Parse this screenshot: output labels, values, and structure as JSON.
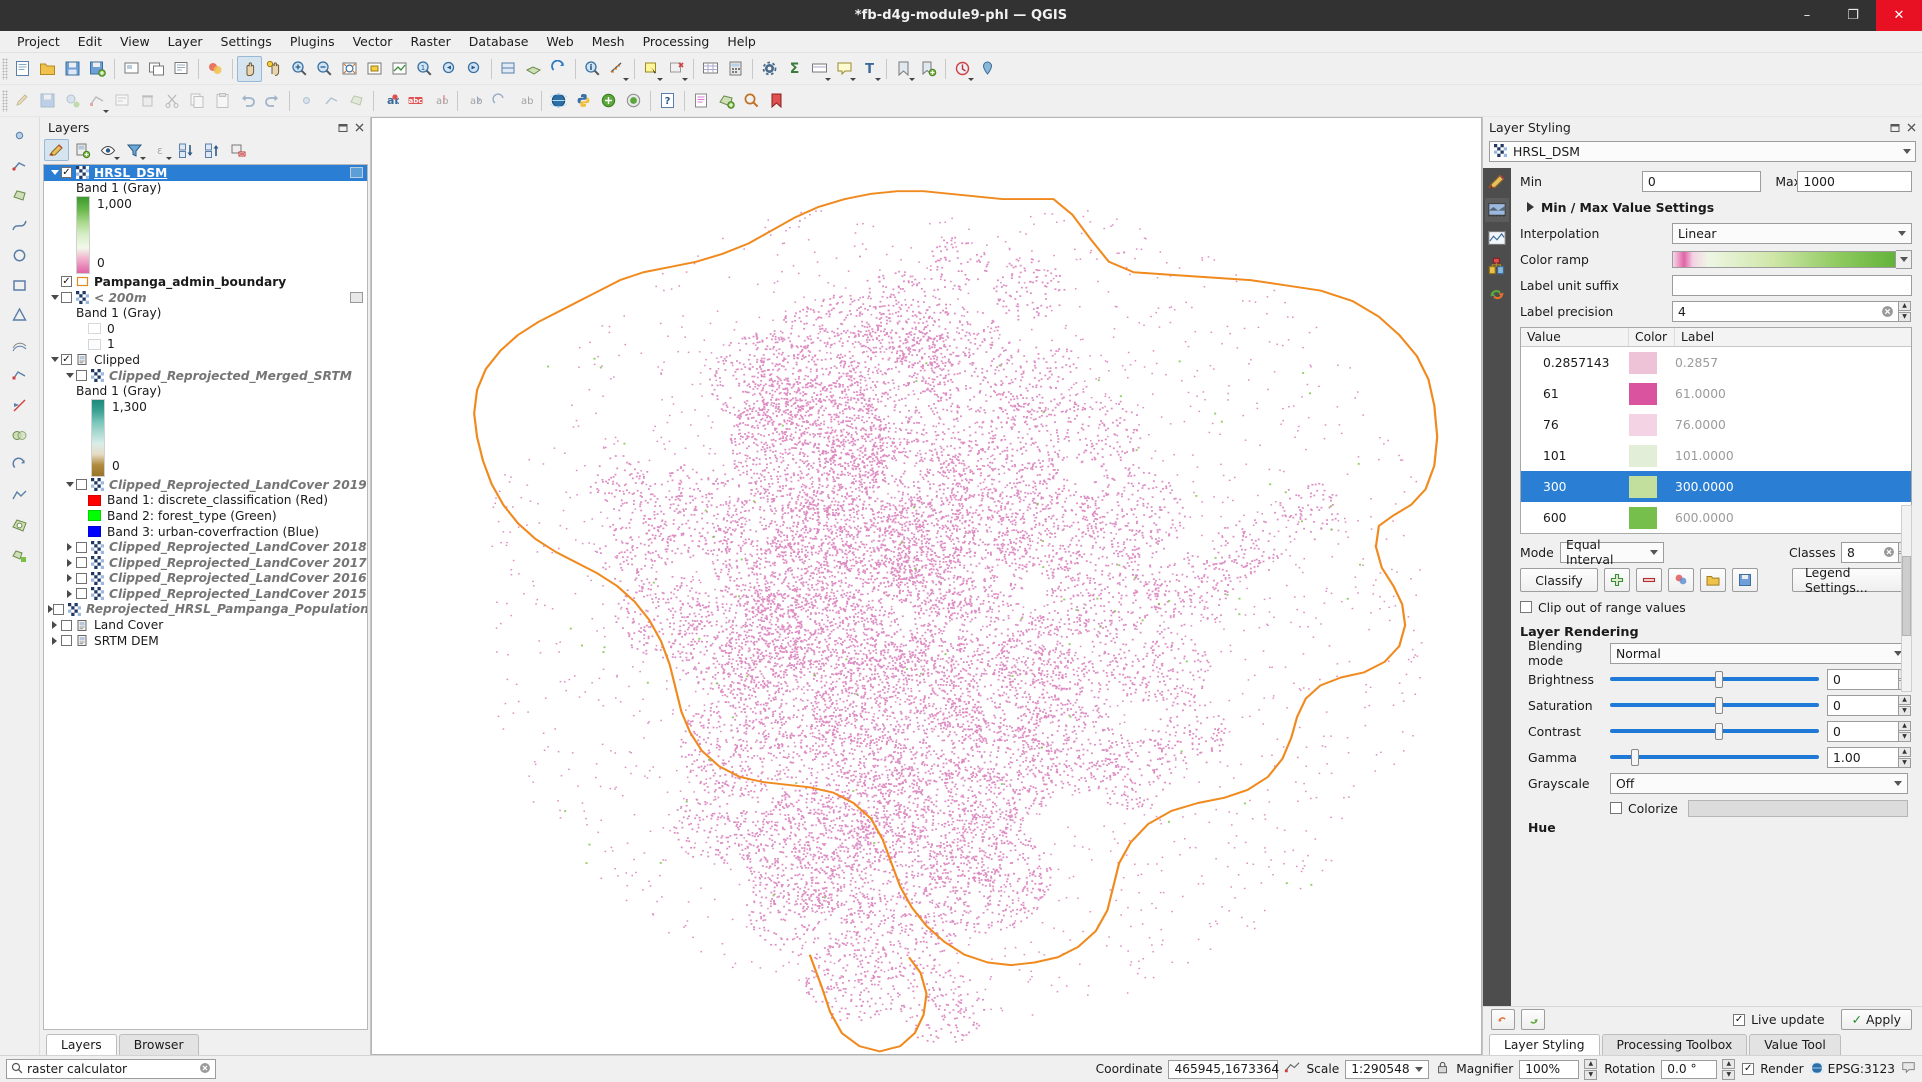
{
  "window": {
    "title": "*fb-d4g-module9-phl — QGIS",
    "minimize": "–",
    "maximize": "❐",
    "close": "✕"
  },
  "menubar": [
    "Project",
    "Edit",
    "View",
    "Layer",
    "Settings",
    "Plugins",
    "Vector",
    "Raster",
    "Database",
    "Web",
    "Mesh",
    "Processing",
    "Help"
  ],
  "layers_panel": {
    "title": "Layers",
    "toolbar_icons": [
      "open-layer-styling-panel-icon",
      "add-group-icon",
      "manage-layer-visibility-icon",
      "filter-legend-icon",
      "filter-legend-expression-icon",
      "expand-all-icon",
      "collapse-all-icon",
      "remove-layer-icon"
    ],
    "tree": [
      {
        "type": "layer",
        "indent": 0,
        "expander": "down",
        "checked": true,
        "selected": true,
        "icon": "raster-icon",
        "name": "HRSL_DSM",
        "style": "bold-underline"
      },
      {
        "type": "text",
        "indent": 1,
        "label": "Band 1 (Gray)"
      },
      {
        "type": "ramp",
        "indent": 1,
        "top": "1,000",
        "bottom": "0",
        "colors": [
          "#3c9a2e",
          "#68b84a",
          "#a9d98c",
          "#d8eec8",
          "#f2f9ea",
          "#f0a8c8",
          "#e063a6"
        ]
      },
      {
        "type": "layer",
        "indent": 0,
        "expander": "none",
        "checked": true,
        "icon": "polygon-outline-icon",
        "name": "Pampanga_admin_boundary",
        "style": "bold"
      },
      {
        "type": "layer",
        "indent": 0,
        "expander": "down",
        "checked": false,
        "icon": "raster-icon",
        "name": "< 200m",
        "style": "italic"
      },
      {
        "type": "text",
        "indent": 1,
        "label": "Band 1 (Gray)"
      },
      {
        "type": "swatch",
        "indent": 2,
        "color": "#ffffff",
        "label": "0"
      },
      {
        "type": "swatch",
        "indent": 2,
        "color": "#fafcfe",
        "label": "1"
      },
      {
        "type": "group",
        "indent": 0,
        "expander": "down",
        "checked": true,
        "icon": "group-icon",
        "name": "Clipped",
        "style": "normal"
      },
      {
        "type": "layer",
        "indent": 1,
        "expander": "down",
        "checked": false,
        "icon": "raster-icon",
        "name": "Clipped_Reprojected_Merged_SRTM",
        "style": "italic"
      },
      {
        "type": "text",
        "indent": 1,
        "label": "Band 1 (Gray)"
      },
      {
        "type": "ramp",
        "indent": 2,
        "top": "1,300",
        "bottom": "0",
        "colors": [
          "#1f8a7a",
          "#3ba193",
          "#76c4b8",
          "#aad9d1",
          "#d8eeea",
          "#e6dcc4",
          "#b08a3e",
          "#9a7528"
        ]
      },
      {
        "type": "layer",
        "indent": 1,
        "expander": "down",
        "checked": false,
        "icon": "raster-icon",
        "name": "Clipped_Reprojected_LandCover 2019",
        "style": "italic"
      },
      {
        "type": "swatch",
        "indent": 2,
        "color": "#ff0000",
        "label": "Band 1: discrete_classification (Red)"
      },
      {
        "type": "swatch",
        "indent": 2,
        "color": "#00ff00",
        "label": "Band 2: forest_type (Green)"
      },
      {
        "type": "swatch",
        "indent": 2,
        "color": "#0000ff",
        "label": "Band 3: urban-coverfraction (Blue)"
      },
      {
        "type": "layer",
        "indent": 1,
        "expander": "right",
        "checked": false,
        "icon": "raster-icon",
        "name": "Clipped_Reprojected_LandCover 2018",
        "style": "italic"
      },
      {
        "type": "layer",
        "indent": 1,
        "expander": "right",
        "checked": false,
        "icon": "raster-icon",
        "name": "Clipped_Reprojected_LandCover 2017",
        "style": "italic"
      },
      {
        "type": "layer",
        "indent": 1,
        "expander": "right",
        "checked": false,
        "icon": "raster-icon",
        "name": "Clipped_Reprojected_LandCover 2016",
        "style": "italic"
      },
      {
        "type": "layer",
        "indent": 1,
        "expander": "right",
        "checked": false,
        "icon": "raster-icon",
        "name": "Clipped_Reprojected_LandCover 2015",
        "style": "italic"
      },
      {
        "type": "layer",
        "indent": 0,
        "expander": "right",
        "checked": false,
        "icon": "raster-icon",
        "name": "Reprojected_HRSL_Pampanga_Population",
        "style": "italic"
      },
      {
        "type": "group",
        "indent": 0,
        "expander": "right",
        "checked": false,
        "icon": "group-icon",
        "name": "Land Cover",
        "style": "normal"
      },
      {
        "type": "group",
        "indent": 0,
        "expander": "right",
        "checked": false,
        "icon": "group-icon",
        "name": "SRTM DEM",
        "style": "normal"
      }
    ],
    "tabs": [
      {
        "label": "Layers",
        "selected": true
      },
      {
        "label": "Browser",
        "selected": false
      }
    ]
  },
  "layer_styling": {
    "title": "Layer Styling",
    "layer_name": "HRSL_DSM",
    "rail_icons": [
      "symbology-icon",
      "transparency-icon",
      "histogram-icon",
      "rendering-icon",
      "undo-redo-icon"
    ],
    "min_label": "Min",
    "min_value": "0",
    "max_label": "Max",
    "max_value": "1000",
    "minmax_section": "Min / Max Value Settings",
    "interpolation_label": "Interpolation",
    "interpolation_value": "Linear",
    "color_ramp_label": "Color ramp",
    "label_unit_suffix_label": "Label unit suffix",
    "label_unit_suffix_value": "",
    "label_precision_label": "Label precision",
    "label_precision_value": "4",
    "table_headers": [
      "Value",
      "Color",
      "Label"
    ],
    "classes": [
      {
        "value": "0.2857143",
        "color": "#eec3d8",
        "label": "0.2857",
        "selected": false
      },
      {
        "value": "61",
        "color": "#d9539e",
        "label": "61.0000",
        "selected": false
      },
      {
        "value": "76",
        "color": "#f4d3e4",
        "label": "76.0000",
        "selected": false
      },
      {
        "value": "101",
        "color": "#e3eed8",
        "label": "101.0000",
        "selected": false
      },
      {
        "value": "300",
        "color": "#c2df9e",
        "label": "300.0000",
        "selected": true
      },
      {
        "value": "600",
        "color": "#77bf4d",
        "label": "600.0000",
        "selected": false
      }
    ],
    "mode_label": "Mode",
    "mode_value": "Equal Interval",
    "classes_label": "Classes",
    "classes_value": "8",
    "classify_label": "Classify",
    "legend_settings_label": "Legend Settings...",
    "clip_out_of_range_label": "Clip out of range values",
    "clip_out_of_range_checked": false,
    "layer_rendering_title": "Layer Rendering",
    "blending_mode_label": "Blending mode",
    "blending_mode_value": "Normal",
    "brightness_label": "Brightness",
    "brightness_value": "0",
    "saturation_label": "Saturation",
    "saturation_value": "0",
    "contrast_label": "Contrast",
    "contrast_value": "0",
    "gamma_label": "Gamma",
    "gamma_value": "1.00",
    "grayscale_label": "Grayscale",
    "grayscale_value": "Off",
    "colorize_label": "Colorize",
    "colorize_checked": false,
    "hue_label": "Hue",
    "live_update_label": "Live update",
    "live_update_checked": true,
    "apply_label": "Apply",
    "tabs": [
      {
        "label": "Layer Styling",
        "selected": true
      },
      {
        "label": "Processing Toolbox",
        "selected": false
      },
      {
        "label": "Value Tool",
        "selected": false
      }
    ]
  },
  "statusbar": {
    "locator_placeholder": "raster calculator",
    "coordinate_label": "Coordinate",
    "coordinate_value": "465945,1673364",
    "scale_label": "Scale",
    "scale_value": "1:290548",
    "magnifier_label": "Magnifier",
    "magnifier_value": "100%",
    "rotation_label": "Rotation",
    "rotation_value": "0.0 °",
    "render_label": "Render",
    "render_checked": true,
    "crs_value": "EPSG:3123"
  },
  "colors": {
    "accent": "#2a7fd4",
    "title_bar": "#323232",
    "close_button": "#e81123",
    "boundary_orange": "#f08a1e",
    "population_pink": "#d070b0"
  }
}
